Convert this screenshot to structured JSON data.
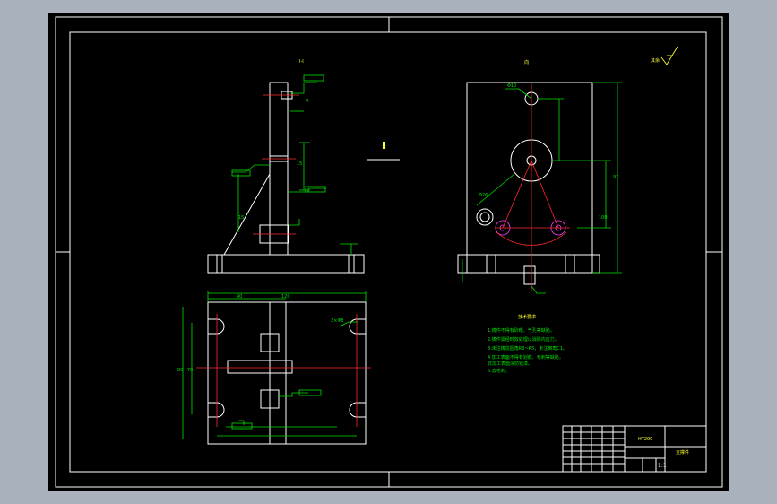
{
  "drawing": {
    "title_block": {
      "part_name": "支撑件",
      "material": "HT200",
      "scale": "1:1"
    },
    "tech_requirements": {
      "title": "技术要求",
      "lines": [
        "1.铸件不得有砂眼、气孔等缺陷。",
        "2.铸件需经时效处理以消除内应力。",
        "3.未注铸造圆角R3~R5，未注倒角C1。",
        "4.加工表面不得有划痕、毛刺等缺陷，",
        "   非加工表面涂防锈漆。",
        "5.去毛刺。"
      ]
    },
    "roughness_note": "其余",
    "section_labels": {
      "front": "I-I",
      "side": "I 向"
    },
    "dimensions": {
      "top_width": "90",
      "overall_width": "120",
      "height_side": "97",
      "height_right": "100",
      "depth_left": "80",
      "depth_inner": "70",
      "slot": "2×Φ8",
      "hole": "Φ26",
      "center_hole": "Φ10"
    },
    "colors": {
      "background": "#000000",
      "outline": "#ffffff",
      "dimension": "#00e000",
      "centerline": "#ff2a2a",
      "text": "#ffff33"
    }
  }
}
